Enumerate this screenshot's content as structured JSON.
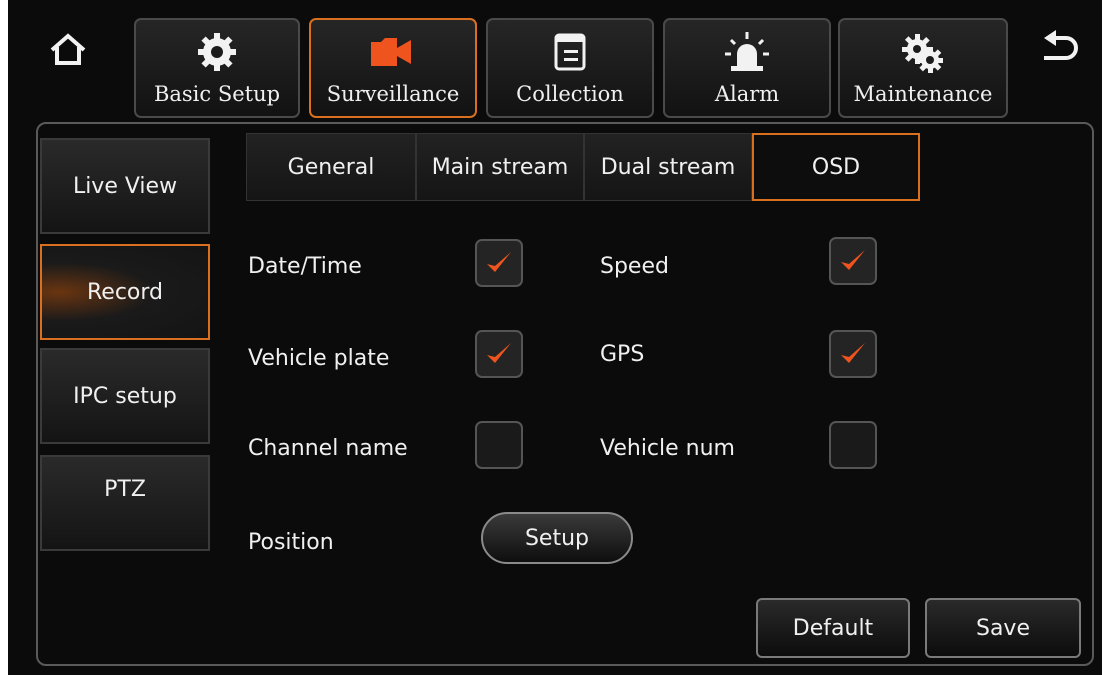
{
  "topnav": {
    "items": [
      {
        "label": "Basic Setup",
        "icon": "gear-icon"
      },
      {
        "label": "Surveillance",
        "icon": "video-camera-icon"
      },
      {
        "label": "Collection",
        "icon": "document-icon"
      },
      {
        "label": "Alarm",
        "icon": "siren-icon"
      },
      {
        "label": "Maintenance",
        "icon": "gears-icon"
      }
    ],
    "active": "Surveillance",
    "home_icon": "home-icon",
    "back_icon": "back-arrow-icon"
  },
  "sidebar": {
    "items": [
      {
        "label": "Live View"
      },
      {
        "label": "Record"
      },
      {
        "label": "IPC setup"
      },
      {
        "label": "PTZ"
      }
    ],
    "active": "Record"
  },
  "tabs": {
    "items": [
      {
        "label": "General"
      },
      {
        "label": "Main stream"
      },
      {
        "label": "Dual stream"
      },
      {
        "label": "OSD"
      }
    ],
    "active": "OSD"
  },
  "osd": {
    "date_time": {
      "label": "Date/Time",
      "checked": true
    },
    "speed": {
      "label": "Speed",
      "checked": true
    },
    "vehicle_plate": {
      "label": "Vehicle plate",
      "checked": true
    },
    "gps": {
      "label": "GPS",
      "checked": true
    },
    "channel_name": {
      "label": "Channel name",
      "checked": false
    },
    "vehicle_num": {
      "label": "Vehicle num",
      "checked": false
    },
    "position": {
      "label": "Position",
      "button": "Setup"
    }
  },
  "actions": {
    "default": "Default",
    "save": "Save"
  },
  "colors": {
    "accent": "#d9701f",
    "check": "#f0541e",
    "background": "#0b0b0b"
  }
}
